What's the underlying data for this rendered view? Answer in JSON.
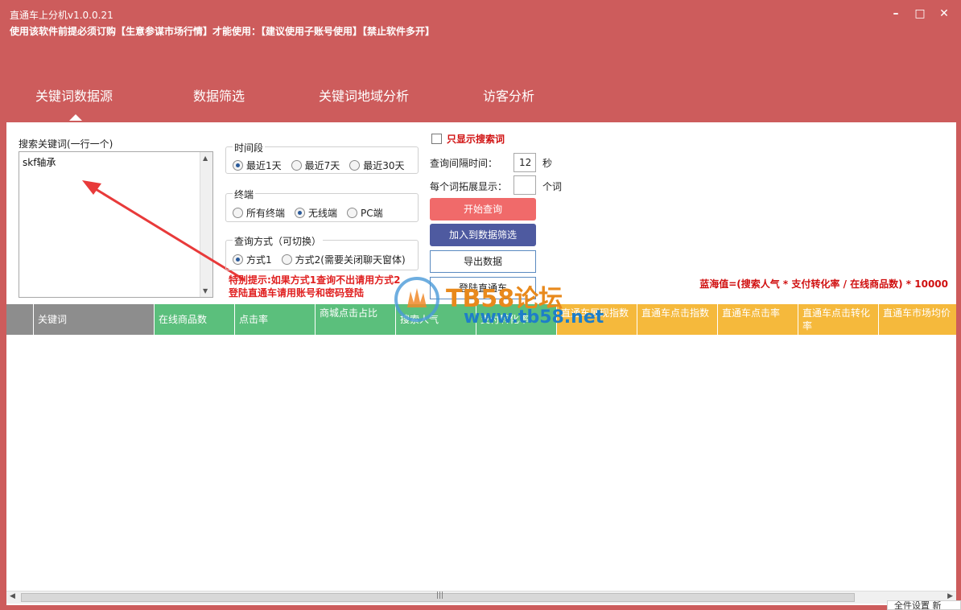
{
  "app": {
    "title": "直通车上分机v1.0.0.21",
    "notice": "使用该软件前提必须订购【生意参谋市场行情】才能使用：【建议使用子账号使用】【禁止软件多开】"
  },
  "window_controls": {
    "minimize": "–",
    "maximize": "□",
    "close": "✕"
  },
  "tabs": [
    {
      "label": "关键词数据源",
      "active": true
    },
    {
      "label": "数据筛选",
      "active": false
    },
    {
      "label": "关键词地域分析",
      "active": false
    },
    {
      "label": "访客分析",
      "active": false
    }
  ],
  "keywords": {
    "label": "搜索关键词(一行一个)",
    "value": "skf轴承"
  },
  "time_period": {
    "title": "时间段",
    "options": [
      "最近1天",
      "最近7天",
      "最近30天"
    ],
    "selected": "最近1天"
  },
  "terminal": {
    "title": "终端",
    "options": [
      "所有终端",
      "无线端",
      "PC端"
    ],
    "selected": "无线端"
  },
  "query_mode": {
    "title": "查询方式（可切换）",
    "options": [
      "方式1",
      "方式2(需要关闭聊天窗体)"
    ],
    "selected": "方式1"
  },
  "warning": {
    "line1": "特别提示:如果方式1查询不出请用方式2",
    "line2": "登陆直通车请用账号和密码登陆"
  },
  "only_search_words": {
    "label": "只显示搜索词",
    "checked": false
  },
  "interval": {
    "label": "查询间隔时间：",
    "value": "12",
    "unit": "秒"
  },
  "expand": {
    "label": "每个词拓展显示：",
    "value": "",
    "unit": "个词"
  },
  "buttons": {
    "start": "开始查询",
    "add_to_filter": "加入到数据筛选",
    "export": "导出数据",
    "login": "登陆直通车"
  },
  "formula": "蓝海值=(搜索人气 * 支付转化率 / 在线商品数) * 10000",
  "watermark": {
    "name": "TB58论坛",
    "url": "www.tb58.net"
  },
  "table": {
    "columns": [
      {
        "label": "关键词",
        "color": "gray"
      },
      {
        "label": "在线商品数",
        "color": "green"
      },
      {
        "label": "点击率",
        "color": "green"
      },
      {
        "label": "商城点击占比",
        "color": "green"
      },
      {
        "label": "搜索人气",
        "color": "green"
      },
      {
        "label": "支付转化率",
        "color": "green"
      },
      {
        "label": "直通车展现指数",
        "color": "orange"
      },
      {
        "label": "直通车点击指数",
        "color": "orange"
      },
      {
        "label": "直通车点击率",
        "color": "orange"
      },
      {
        "label": "直通车点击转化率",
        "color": "orange"
      },
      {
        "label": "直通车市场均价",
        "color": "orange"
      }
    ],
    "rows": []
  },
  "popup": "全件设置   新"
}
